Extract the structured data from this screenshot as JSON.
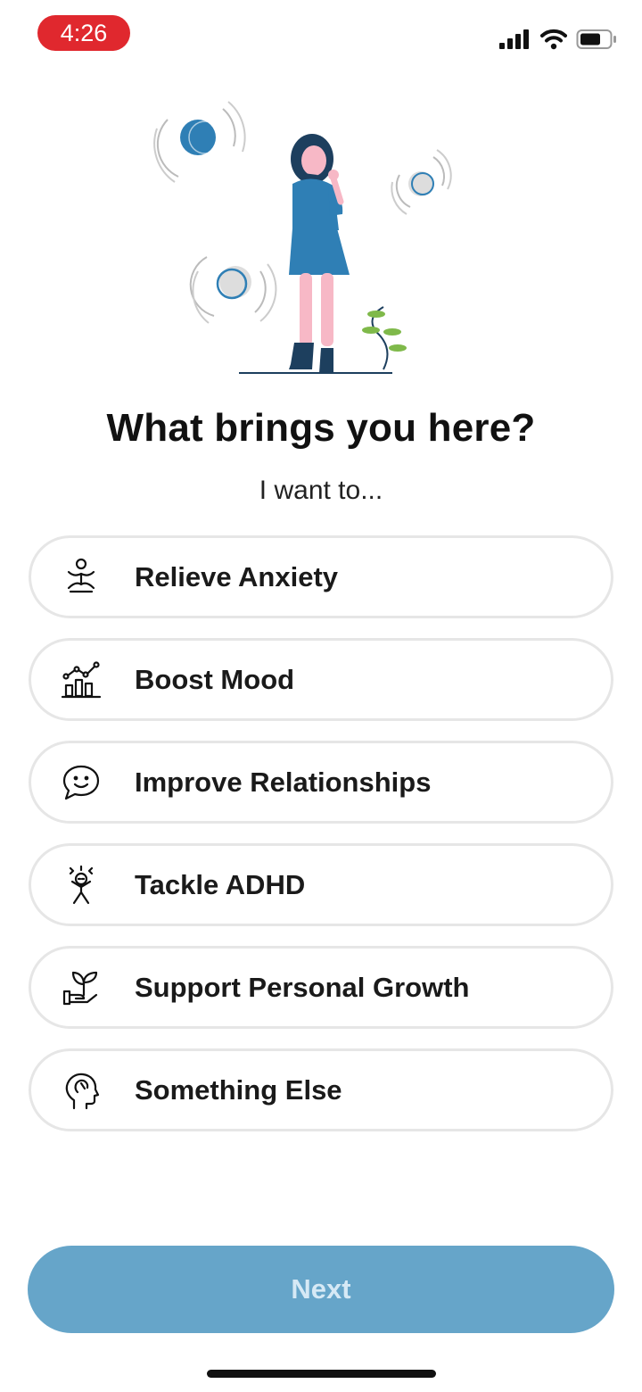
{
  "status_bar": {
    "time": "4:26",
    "icons": [
      "signal-icon",
      "wifi-icon",
      "battery-icon"
    ],
    "time_pill_color": "#e0282e"
  },
  "illustration": {
    "icon": "woman-thinking-illustration"
  },
  "heading": "What brings you here?",
  "subheading": "I want to...",
  "options": [
    {
      "label": "Relieve Anxiety",
      "icon": "meditation-icon"
    },
    {
      "label": "Boost Mood",
      "icon": "rising-chart-icon"
    },
    {
      "label": "Improve Relationships",
      "icon": "smiling-chat-icon"
    },
    {
      "label": "Tackle ADHD",
      "icon": "stressed-person-icon"
    },
    {
      "label": "Support Personal Growth",
      "icon": "sprouting-hand-icon"
    },
    {
      "label": "Something Else",
      "icon": "head-profile-icon"
    }
  ],
  "next_button": {
    "label": "Next",
    "color": "#66a5c9",
    "state": "disabled"
  }
}
